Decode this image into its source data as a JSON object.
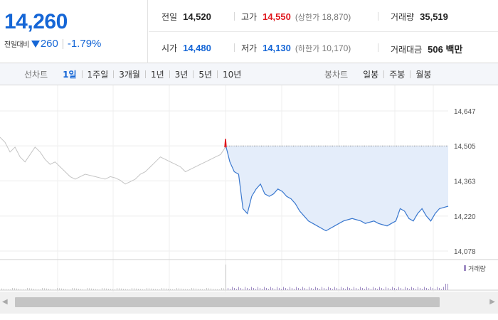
{
  "quote": {
    "price": "14,260",
    "change_label": "전일대비",
    "change_amount": "260",
    "change_rate": "-1.79%",
    "direction_icon": "down-triangle-icon"
  },
  "stats": {
    "prev_close": {
      "label": "전일",
      "value": "14,520"
    },
    "high": {
      "label": "고가",
      "value": "14,550",
      "sub_label": "상한가",
      "sub_value": "18,870"
    },
    "volume": {
      "label": "거래량",
      "value": "35,519"
    },
    "open": {
      "label": "시가",
      "value": "14,480"
    },
    "low": {
      "label": "저가",
      "value": "14,130",
      "sub_label": "하한가",
      "sub_value": "10,170"
    },
    "trade_value": {
      "label": "거래대금",
      "value": "506 백만"
    }
  },
  "tabs": {
    "line_group": "선차트",
    "line_items": [
      "1일",
      "1주일",
      "3개월",
      "1년",
      "3년",
      "5년",
      "10년"
    ],
    "line_active": 0,
    "candle_group": "봉차트",
    "candle_items": [
      "일봉",
      "주봉",
      "월봉"
    ]
  },
  "colors": {
    "accent": "#1566d6",
    "up": "#e0161c",
    "prev_day_line": "#c4c4c4",
    "today_line": "#3a78cf",
    "today_fill": "#e4edfa",
    "volume_bar": "#9f8cc4"
  },
  "chart_data": {
    "type": "line",
    "ylim": [
      14078,
      14647
    ],
    "y_ticks": [
      "14,647",
      "14,505",
      "14,363",
      "14,220",
      "14,078"
    ],
    "reference_value": 14505,
    "volume_legend": "거래량",
    "series": [
      {
        "values": [
          14540,
          14520,
          14480,
          14500,
          14460,
          14440,
          14470,
          14500,
          14480,
          14450,
          14430,
          14440,
          14420,
          14400,
          14380,
          14370,
          14380,
          14390,
          14385,
          14380,
          14375,
          14370,
          14380,
          14375,
          14365,
          14350,
          14360,
          14370,
          14390,
          14400,
          14420,
          14440,
          14460,
          14450,
          14440,
          14430,
          14420,
          14400,
          14410,
          14420,
          14430,
          14440,
          14450,
          14460,
          14470,
          14500
        ]
      },
      {
        "values": [
          14510,
          14440,
          14400,
          14390,
          14250,
          14230,
          14300,
          14330,
          14350,
          14310,
          14300,
          14310,
          14330,
          14320,
          14300,
          14290,
          14270,
          14240,
          14220,
          14200,
          14190,
          14180,
          14170,
          14160,
          14170,
          14180,
          14190,
          14200,
          14205,
          14210,
          14205,
          14200,
          14190,
          14195,
          14200,
          14190,
          14185,
          14180,
          14190,
          14200,
          14250,
          14240,
          14210,
          14200,
          14230,
          14250,
          14220,
          14200,
          14230,
          14250,
          14255,
          14260
        ]
      }
    ]
  }
}
